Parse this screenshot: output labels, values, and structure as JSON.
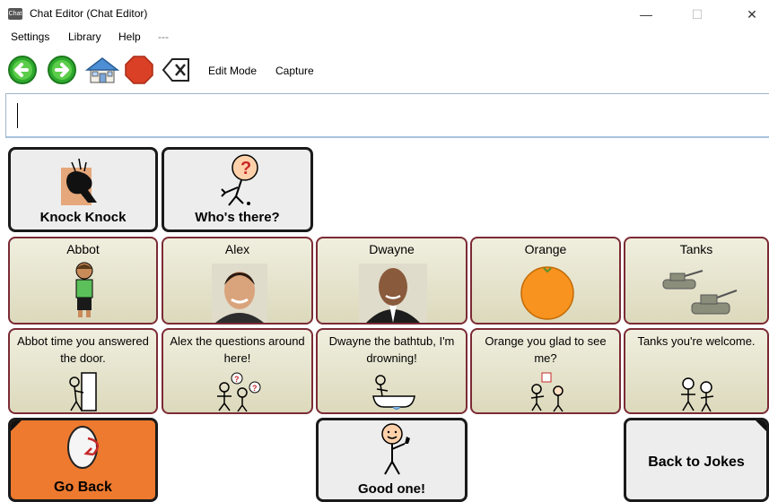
{
  "window": {
    "title": "Chat Editor (Chat Editor)",
    "app_icon_text": "Chat",
    "controls": {
      "minimize": "—",
      "maximize": "☐",
      "close": "✕"
    }
  },
  "menu": {
    "items": [
      "Settings",
      "Library",
      "Help",
      "---"
    ]
  },
  "toolbar": {
    "edit_mode": "Edit Mode",
    "capture": "Capture",
    "icons": [
      "back-arrow-icon",
      "forward-arrow-icon",
      "home-icon",
      "stop-icon",
      "clear-icon"
    ]
  },
  "message_bar": {
    "value": ""
  },
  "grid": {
    "row1": {
      "knock": "Knock Knock",
      "whos_there": "Who's there?"
    },
    "names": [
      "Abbot",
      "Alex",
      "Dwayne",
      "Orange",
      "Tanks"
    ],
    "punchlines": [
      "Abbot time you answered the door.",
      "Alex the questions around here!",
      "Dwayne the bathtub, I'm drowning!",
      "Orange you glad to see me?",
      "Tanks you're welcome."
    ],
    "row4": {
      "go_back": "Go Back",
      "good_one": "Good one!",
      "back_to_jokes": "Back to Jokes"
    }
  },
  "colors": {
    "orange_button": "#ED7A2F",
    "maroon_border": "#7B2B35",
    "cell_fill": "#E8E6CF",
    "nav_green": "#2EAA2E",
    "stop_red": "#D94025"
  }
}
